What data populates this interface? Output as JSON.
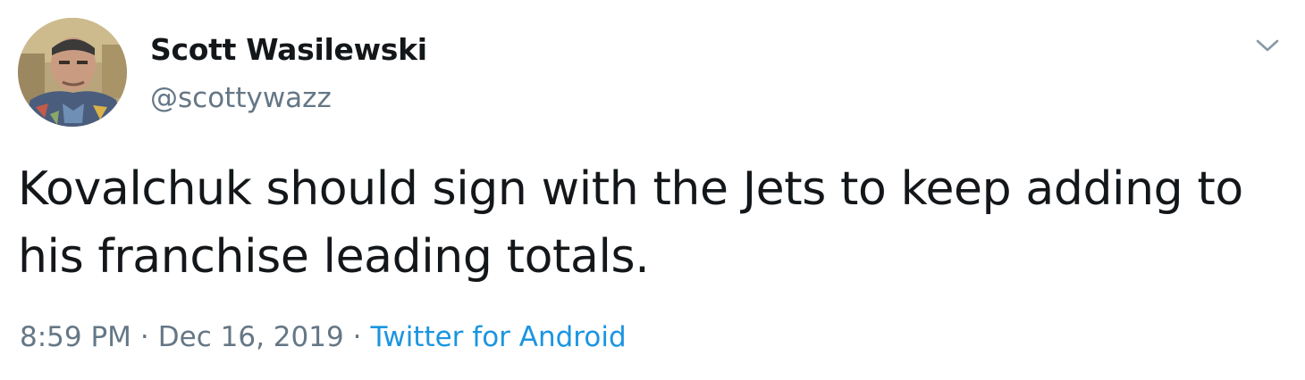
{
  "author": {
    "display_name": "Scott Wasilewski",
    "handle": "@scottywazz",
    "avatar_icon": "user-avatar-photo"
  },
  "menu": {
    "icon": "chevron-down-icon"
  },
  "tweet": {
    "text": "Kovalchuk should sign with the Jets to keep adding to his franchise leading totals."
  },
  "meta": {
    "time": "8:59 PM",
    "separator": "·",
    "date": "Dec 16, 2019",
    "source": "Twitter for Android"
  },
  "colors": {
    "text": "#14171a",
    "muted": "#657786",
    "link": "#1b95e0"
  }
}
